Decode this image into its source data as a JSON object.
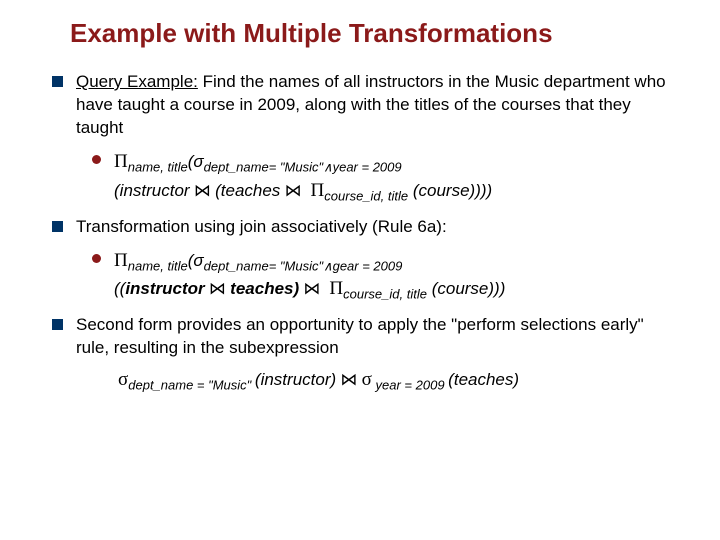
{
  "title": "Example with Multiple Transformations",
  "bullet1": {
    "label": "Query Example:",
    "text": " Find the names of all instructors in the Music department who have taught a course in 2009, along with the titles of the courses that they taught",
    "formula_line1_a": "Π",
    "formula_line1_b": "name, title",
    "formula_line1_c": "(σ",
    "formula_line1_d": "dept_name= \"Music\"",
    "formula_wedge": "∧",
    "formula_line1_e": "year = 2009",
    "formula_line2_a": "(",
    "formula_line2_b": "instructor",
    "formula_line2_join": " ⋈ ",
    "formula_line2_c": "(",
    "formula_line2_d": "teaches",
    "formula_line2_e": "Π",
    "formula_line2_f": "course_id, title",
    "formula_line2_g": " (",
    "formula_line2_h": "course",
    "formula_line2_i": "))))"
  },
  "bullet2": {
    "text": "Transformation using join associatively (Rule 6a):",
    "formula_line1_a": "Π",
    "formula_line1_b": "name, title",
    "formula_line1_c": "(σ",
    "formula_line1_d": "dept_name= \"Music\"",
    "formula_wedge": "∧",
    "formula_line1_e": "gear = 2009",
    "formula_line2_a": "((",
    "formula_line2_b": "instructor",
    "formula_line2_join": " ⋈ ",
    "formula_line2_c": "teaches",
    "formula_line2_d": ")",
    "formula_line2_e": "Π",
    "formula_line2_f": "course_id, title",
    "formula_line2_g": " (",
    "formula_line2_h": "course",
    "formula_line2_i": ")))"
  },
  "bullet3": {
    "text": "Second form provides an opportunity to apply the \"perform selections early\" rule, resulting in the subexpression",
    "formula_a": "σ",
    "formula_b": "dept_name = \"Music\" ",
    "formula_c": "(",
    "formula_d": "instructor",
    "formula_e": ")",
    "formula_join": " ⋈ ",
    "formula_f": "σ",
    "formula_g": " year = 2009 ",
    "formula_h": "(",
    "formula_i": "teaches",
    "formula_j": ")"
  }
}
